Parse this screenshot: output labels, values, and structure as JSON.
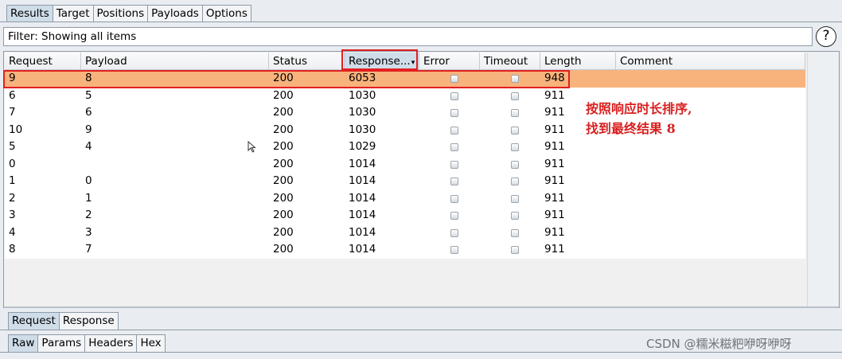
{
  "top_tabs": [
    "Results",
    "Target",
    "Positions",
    "Payloads",
    "Options"
  ],
  "filter": {
    "text": "Filter: Showing all items",
    "help": "?"
  },
  "table": {
    "columns": [
      "Request",
      "Payload",
      "Status",
      "Response...",
      "Error",
      "Timeout",
      "Length",
      "Comment"
    ],
    "sort_indicator": "▾",
    "rows": [
      {
        "request": "9",
        "payload": "8",
        "status": "200",
        "response": "6053",
        "error": false,
        "timeout": false,
        "length": "948",
        "comment": "",
        "selected": true
      },
      {
        "request": "6",
        "payload": "5",
        "status": "200",
        "response": "1030",
        "error": false,
        "timeout": false,
        "length": "911",
        "comment": ""
      },
      {
        "request": "7",
        "payload": "6",
        "status": "200",
        "response": "1030",
        "error": false,
        "timeout": false,
        "length": "911",
        "comment": ""
      },
      {
        "request": "10",
        "payload": "9",
        "status": "200",
        "response": "1030",
        "error": false,
        "timeout": false,
        "length": "911",
        "comment": ""
      },
      {
        "request": "5",
        "payload": "4",
        "status": "200",
        "response": "1029",
        "error": false,
        "timeout": false,
        "length": "911",
        "comment": ""
      },
      {
        "request": "0",
        "payload": "",
        "status": "200",
        "response": "1014",
        "error": false,
        "timeout": false,
        "length": "911",
        "comment": ""
      },
      {
        "request": "1",
        "payload": "0",
        "status": "200",
        "response": "1014",
        "error": false,
        "timeout": false,
        "length": "911",
        "comment": ""
      },
      {
        "request": "2",
        "payload": "1",
        "status": "200",
        "response": "1014",
        "error": false,
        "timeout": false,
        "length": "911",
        "comment": ""
      },
      {
        "request": "3",
        "payload": "2",
        "status": "200",
        "response": "1014",
        "error": false,
        "timeout": false,
        "length": "911",
        "comment": ""
      },
      {
        "request": "4",
        "payload": "3",
        "status": "200",
        "response": "1014",
        "error": false,
        "timeout": false,
        "length": "911",
        "comment": ""
      },
      {
        "request": "8",
        "payload": "7",
        "status": "200",
        "response": "1014",
        "error": false,
        "timeout": false,
        "length": "911",
        "comment": ""
      }
    ]
  },
  "annotation": {
    "line1": "按照响应时长排序,",
    "line2": "找到最终结果 8",
    "color": "#d81f1f"
  },
  "detail_tabs": [
    "Request",
    "Response"
  ],
  "view_tabs": [
    "Raw",
    "Params",
    "Headers",
    "Hex"
  ],
  "watermark": "CSDN @糯米糍粑咿呀咿呀",
  "colors": {
    "selected_row": "#f8b37d",
    "active_tab": "#cfdde9",
    "highlight_box": "#e12020"
  }
}
